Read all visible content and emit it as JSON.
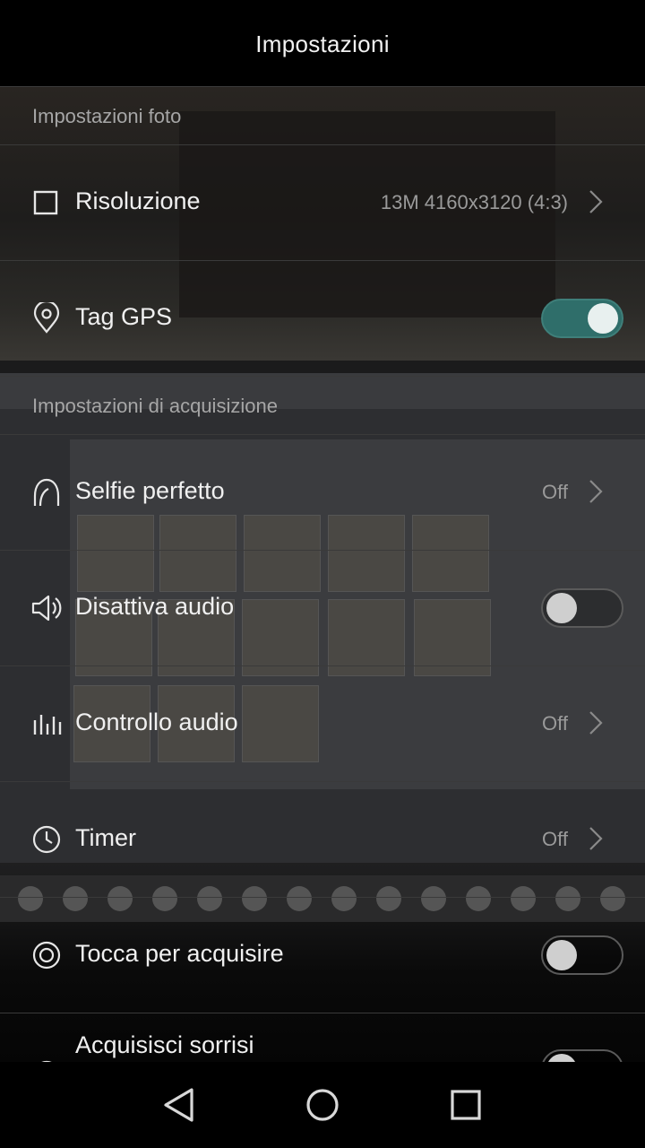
{
  "header": {
    "title": "Impostazioni"
  },
  "sections": {
    "photo": {
      "label": "Impostazioni foto"
    },
    "capture": {
      "label": "Impostazioni di acquisizione"
    }
  },
  "rows": {
    "resolution": {
      "label": "Risoluzione",
      "value": "13M 4160x3120 (4:3)",
      "icon": "square-icon"
    },
    "gps": {
      "label": "Tag GPS",
      "toggle": true,
      "icon": "location-pin-icon"
    },
    "selfie": {
      "label": "Selfie perfetto",
      "value": "Off",
      "icon": "face-icon"
    },
    "mute": {
      "label": "Disattiva audio",
      "toggle": false,
      "icon": "speaker-icon"
    },
    "audio_control": {
      "label": "Controllo audio",
      "value": "Off",
      "icon": "equalizer-icon"
    },
    "timer": {
      "label": "Timer",
      "value": "Off",
      "icon": "clock-icon"
    },
    "touch_capture": {
      "label": "Tocca per acquisire",
      "toggle": false,
      "icon": "target-icon"
    },
    "smile_capture": {
      "label": "Acquisisci sorrisi",
      "toggle": false,
      "icon": "smile-icon"
    }
  },
  "colors": {
    "toggle_on": "#2f6e6a",
    "background": "#000000"
  }
}
